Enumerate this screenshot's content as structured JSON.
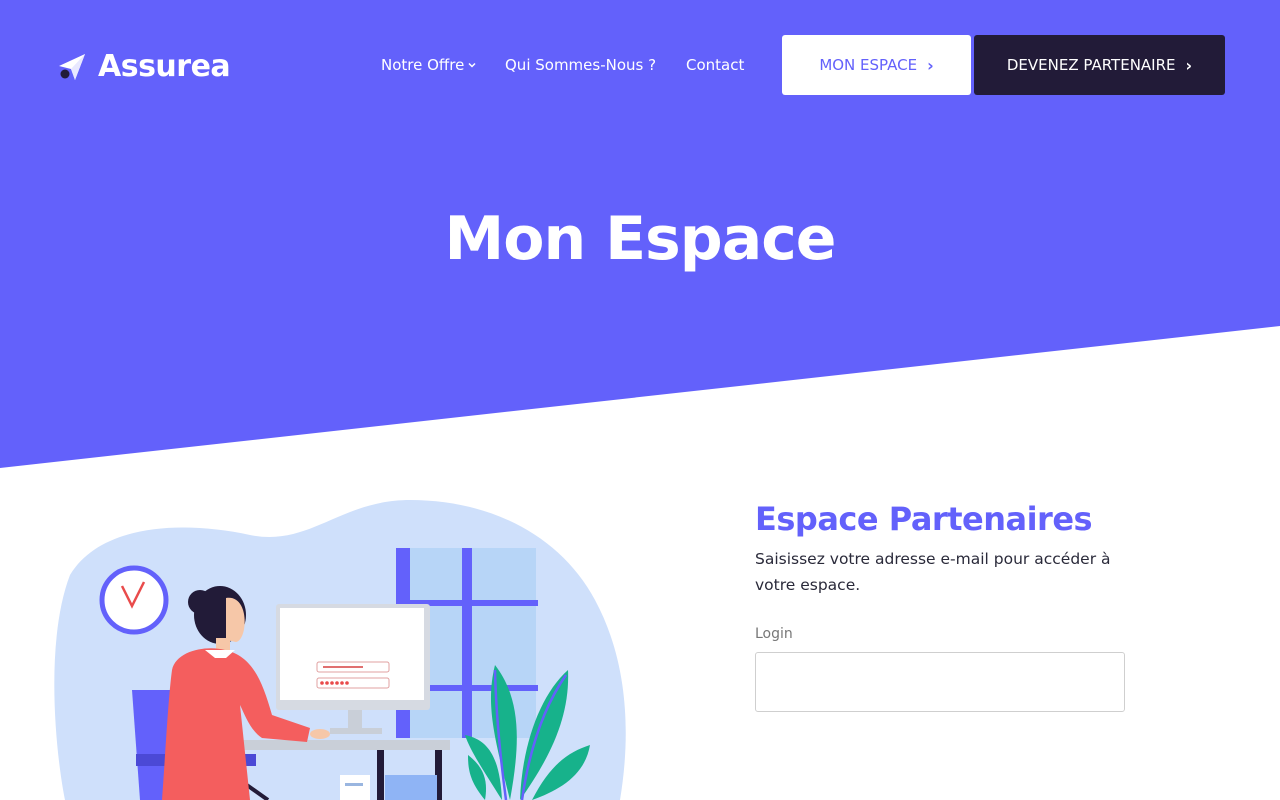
{
  "colors": {
    "brand": "#6361FB",
    "dark": "#221B38",
    "white": "#FFFFFF"
  },
  "header": {
    "logo_text": "Assurea",
    "logo_icon": "paper-plane-icon",
    "menu": [
      {
        "label": "Notre Offre",
        "has_dropdown": true
      },
      {
        "label": "Qui Sommes-Nous ?"
      },
      {
        "label": "Contact"
      }
    ],
    "buttons": {
      "mon_espace": "MON ESPACE",
      "devenez_partenaire": "DEVENEZ PARTENAIRE"
    }
  },
  "hero": {
    "title": "Mon Espace"
  },
  "login": {
    "heading": "Espace Partenaires",
    "description": "Saisissez votre adresse e-mail pour accéder à votre espace.",
    "login_label": "Login",
    "login_value": ""
  }
}
